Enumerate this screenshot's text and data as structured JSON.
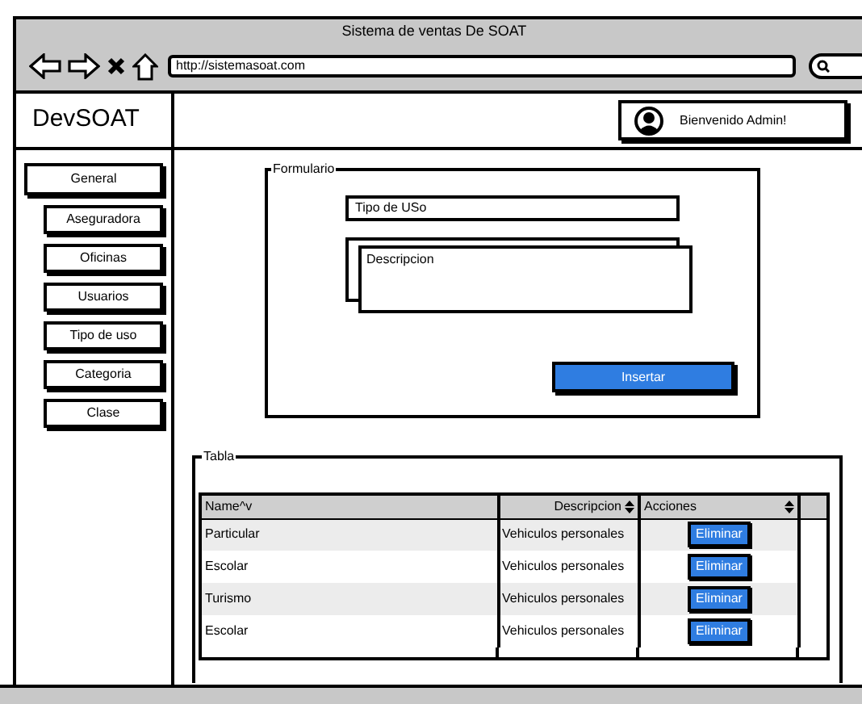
{
  "window": {
    "title": "Sistema de ventas De SOAT",
    "url": "http://sistemasoat.com"
  },
  "header": {
    "logo": "DevSOAT",
    "user_greeting": "Bienvenido Admin!"
  },
  "sidebar": {
    "items": [
      {
        "label": "General",
        "kind": "group"
      },
      {
        "label": "Aseguradora",
        "kind": "sub"
      },
      {
        "label": "Oficinas",
        "kind": "sub"
      },
      {
        "label": "Usuarios",
        "kind": "sub"
      },
      {
        "label": "Tipo de uso",
        "kind": "sub"
      },
      {
        "label": "Categoria",
        "kind": "sub"
      },
      {
        "label": "Clase",
        "kind": "sub"
      }
    ]
  },
  "form": {
    "legend": "Formulario",
    "fields": [
      {
        "kind": "input",
        "value": "Tipo de USo"
      },
      {
        "kind": "textarea",
        "value": "Descripcion"
      }
    ],
    "submit": "Insertar"
  },
  "table_panel": {
    "legend": "Tabla",
    "columns": [
      {
        "label": "Name^v",
        "sortable": false
      },
      {
        "label": "Descripcion",
        "sortable": true
      },
      {
        "label": "Acciones",
        "sortable": true
      }
    ],
    "rows": [
      {
        "name": "Particular",
        "description": "Vehiculos personales",
        "action": "Eliminar"
      },
      {
        "name": "Escolar",
        "description": "Vehiculos personales",
        "action": "Eliminar"
      },
      {
        "name": "Turismo",
        "description": "Vehiculos personales",
        "action": "Eliminar"
      },
      {
        "name": "Escolar",
        "description": "Vehiculos personales",
        "action": "Eliminar"
      }
    ]
  }
}
